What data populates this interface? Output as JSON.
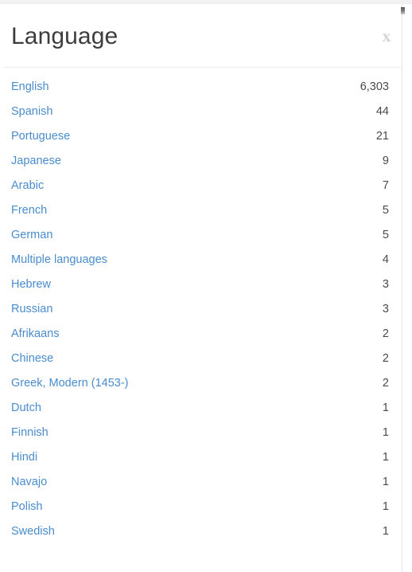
{
  "colors": {
    "link": "#4a8ccc",
    "count_text": "#4a4a4a",
    "title_text": "#3d3d3d",
    "close_icon": "#d4d4d4",
    "divider": "#ececec",
    "panel_background": "#ffffff",
    "top_band": "#f2f2f2"
  },
  "panel": {
    "title": "Language",
    "close_label": "x",
    "close_icon_name": "close-icon"
  },
  "facets": [
    {
      "label": "English",
      "count": "6,303"
    },
    {
      "label": "Spanish",
      "count": "44"
    },
    {
      "label": "Portuguese",
      "count": "21"
    },
    {
      "label": "Japanese",
      "count": "9"
    },
    {
      "label": "Arabic",
      "count": "7"
    },
    {
      "label": "French",
      "count": "5"
    },
    {
      "label": "German",
      "count": "5"
    },
    {
      "label": "Multiple languages",
      "count": "4"
    },
    {
      "label": "Hebrew",
      "count": "3"
    },
    {
      "label": "Russian",
      "count": "3"
    },
    {
      "label": "Afrikaans",
      "count": "2"
    },
    {
      "label": "Chinese",
      "count": "2"
    },
    {
      "label": "Greek, Modern (1453-)",
      "count": "2"
    },
    {
      "label": "Dutch",
      "count": "1"
    },
    {
      "label": "Finnish",
      "count": "1"
    },
    {
      "label": "Hindi",
      "count": "1"
    },
    {
      "label": "Navajo",
      "count": "1"
    },
    {
      "label": "Polish",
      "count": "1"
    },
    {
      "label": "Swedish",
      "count": "1"
    }
  ]
}
